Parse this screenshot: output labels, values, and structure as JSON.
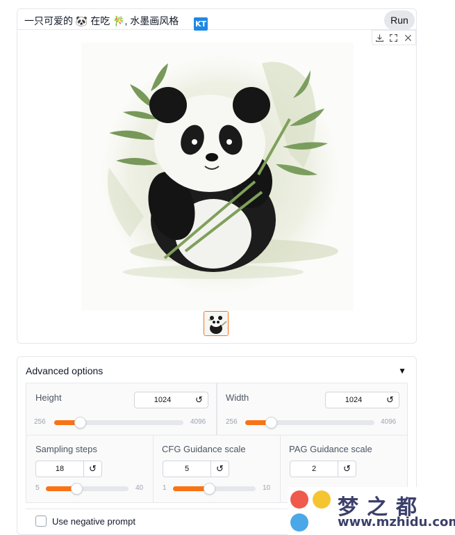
{
  "prompt": {
    "text": "一只可爱的 🐼 在吃 🎋, 水墨画风格",
    "run_label": "Run"
  },
  "badge": {
    "text": "KT"
  },
  "toolbar": {
    "icons": [
      "download-icon",
      "fullscreen-icon",
      "close-icon"
    ]
  },
  "gallery": {
    "main_image": "panda-eating-bamboo-ink-painting",
    "thumbnail_selected": true
  },
  "advanced": {
    "title": "Advanced options",
    "toggle_glyph": "▼",
    "height": {
      "label": "Height",
      "value": "1024",
      "min": "256",
      "max": "4096",
      "fraction": 0.2
    },
    "width": {
      "label": "Width",
      "value": "1024",
      "min": "256",
      "max": "4096",
      "fraction": 0.2
    },
    "sampling_steps": {
      "label": "Sampling steps",
      "value": "18",
      "min": "5",
      "max": "40",
      "fraction": 0.37
    },
    "cfg_scale": {
      "label": "CFG Guidance scale",
      "value": "5",
      "min": "1",
      "max": "10",
      "fraction": 0.44
    },
    "pag_scale": {
      "label": "PAG Guidance scale",
      "value": "2",
      "min": "",
      "max": ""
    },
    "reset_glyph": "↺",
    "negative_prompt_label": "Use negative prompt"
  },
  "watermark": {
    "text": "梦之都",
    "url": "www.mzhidu.com"
  },
  "colors": {
    "accent": "#f97316",
    "badge": "#1e88e5",
    "watermark": "#3b3f6b"
  }
}
